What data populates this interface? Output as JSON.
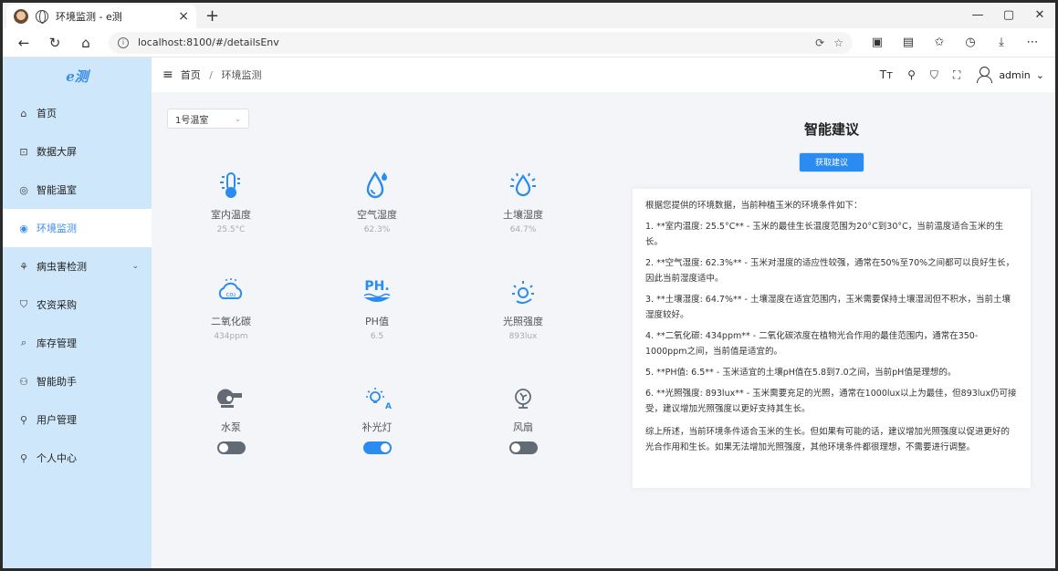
{
  "browser": {
    "tab_title": "环境监测 - e测",
    "url": "localhost:8100/#/detailsEnv",
    "new_tab": "+",
    "tab_close": "×"
  },
  "app": {
    "logo": "e测",
    "breadcrumb": {
      "home": "首页",
      "current": "环境监测",
      "separator": "/"
    },
    "user": {
      "name": "admin"
    }
  },
  "sidebar": {
    "items": [
      {
        "label": "首页",
        "icon": "home-icon",
        "glyph": "⌂"
      },
      {
        "label": "数据大屏",
        "icon": "chart-icon",
        "glyph": "⊡"
      },
      {
        "label": "智能温室",
        "icon": "greenhouse-icon",
        "glyph": "◎"
      },
      {
        "label": "环境监测",
        "icon": "monitor-icon",
        "glyph": "◉",
        "active": true
      },
      {
        "label": "病虫害检测",
        "icon": "bug-icon",
        "glyph": "⚘",
        "expandable": true
      },
      {
        "label": "农资采购",
        "icon": "cart-icon",
        "glyph": "⛉"
      },
      {
        "label": "库存管理",
        "icon": "inventory-icon",
        "glyph": "⌕"
      },
      {
        "label": "智能助手",
        "icon": "assistant-icon",
        "glyph": "⚇"
      },
      {
        "label": "用户管理",
        "icon": "users-icon",
        "glyph": "⚲"
      },
      {
        "label": "个人中心",
        "icon": "person-icon",
        "glyph": "⚲"
      }
    ]
  },
  "greenhouse_select": {
    "value": "1号温室"
  },
  "sensors": [
    {
      "name": "室内温度",
      "value": "25.5°C",
      "icon": "thermometer-icon"
    },
    {
      "name": "空气湿度",
      "value": "62.3%",
      "icon": "droplet-icon"
    },
    {
      "name": "土壤湿度",
      "value": "64.7%",
      "icon": "soil-moisture-icon"
    },
    {
      "name": "二氧化碳",
      "value": "434ppm",
      "icon": "co2-icon"
    },
    {
      "name": "PH值",
      "value": "6.5",
      "icon": "ph-icon"
    },
    {
      "name": "光照强度",
      "value": "893lux",
      "icon": "light-icon"
    }
  ],
  "devices": [
    {
      "name": "水泵",
      "on": false,
      "icon": "pump-icon"
    },
    {
      "name": "补光灯",
      "on": true,
      "icon": "lamp-icon"
    },
    {
      "name": "风扇",
      "on": false,
      "icon": "fan-icon"
    }
  ],
  "advice": {
    "title": "智能建议",
    "button": "获取建议",
    "intro": "根据您提供的环境数据，当前种植玉米的环境条件如下：",
    "points": [
      "1. **室内温度: 25.5°C** - 玉米的最佳生长温度范围为20°C到30°C，当前温度适合玉米的生长。",
      "2. **空气湿度: 62.3%** - 玉米对湿度的适应性较强，通常在50%至70%之间都可以良好生长，因此当前湿度适中。",
      "3. **土壤湿度: 64.7%** - 土壤湿度在适宜范围内，玉米需要保持土壤湿润但不积水，当前土壤湿度较好。",
      "4. **二氧化碳: 434ppm** - 二氧化碳浓度在植物光合作用的最佳范围内，通常在350-1000ppm之间，当前值是适宜的。",
      "5. **PH值: 6.5** - 玉米适宜的土壤pH值在5.8到7.0之间，当前pH值是理想的。",
      "6. **光照强度: 893lux** - 玉米需要充足的光照，通常在1000lux以上为最佳，但893lux仍可接受，建议增加光照强度以更好支持其生长。"
    ],
    "closing": "综上所述，当前环境条件适合玉米的生长。但如果有可能的话，建议增加光照强度以促进更好的光合作用和生长。如果无法增加光照强度，其他环境条件都很理想，不需要进行调整。"
  },
  "colors": {
    "accent": "#2a8cf0",
    "sidebar_bg": "#cfe7fb",
    "toggle_off": "#626b75"
  }
}
